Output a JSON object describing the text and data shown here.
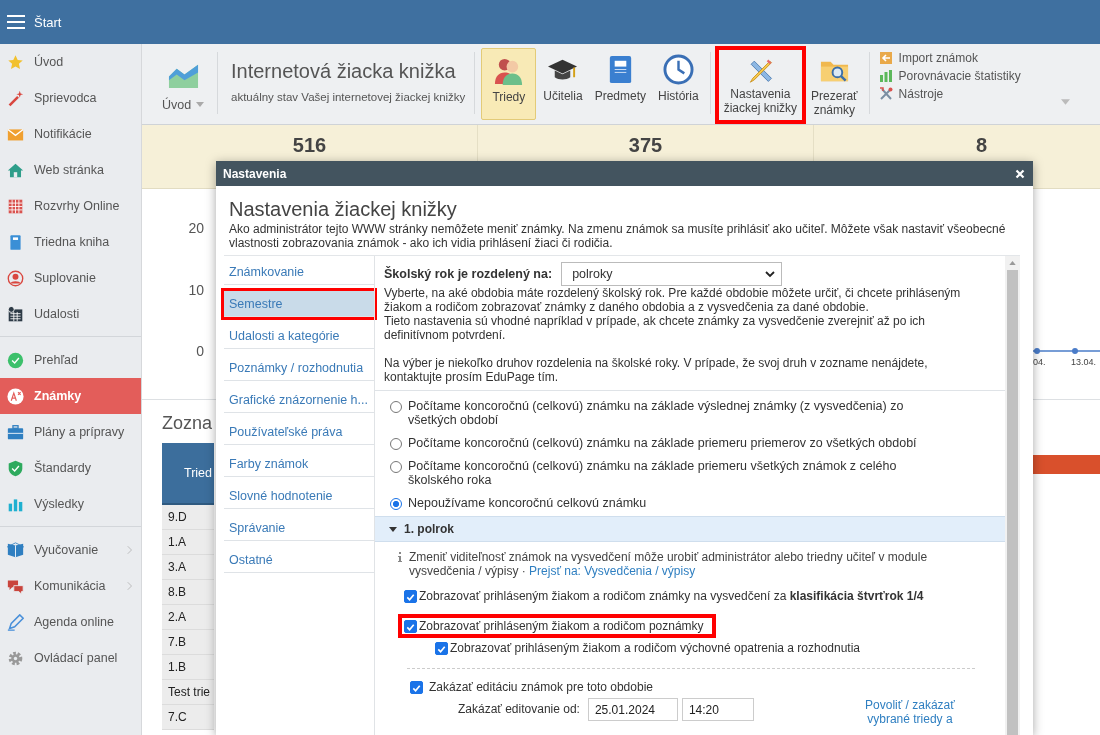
{
  "top_bar": {
    "title": "Štart"
  },
  "sidebar": {
    "groups": [
      [
        {
          "label": "Úvod",
          "selected": false,
          "expandable": false
        },
        {
          "label": "Sprievodca",
          "selected": false,
          "expandable": false
        },
        {
          "label": "Notifikácie",
          "selected": false,
          "expandable": false
        },
        {
          "label": "Web stránka",
          "selected": false,
          "expandable": false
        },
        {
          "label": "Rozvrhy Online",
          "selected": false,
          "expandable": false
        },
        {
          "label": "Triedna kniha",
          "selected": false,
          "expandable": false
        },
        {
          "label": "Suplovanie",
          "selected": false,
          "expandable": false
        },
        {
          "label": "Udalosti",
          "selected": false,
          "expandable": false
        }
      ],
      [
        {
          "label": "Prehľad",
          "selected": false,
          "expandable": false
        },
        {
          "label": "Známky",
          "selected": true,
          "expandable": false
        },
        {
          "label": "Plány a prípravy",
          "selected": false,
          "expandable": false
        },
        {
          "label": "Štandardy",
          "selected": false,
          "expandable": false
        },
        {
          "label": "Výsledky",
          "selected": false,
          "expandable": false
        }
      ],
      [
        {
          "label": "Vyučovanie",
          "selected": false,
          "expandable": true
        },
        {
          "label": "Komunikácia",
          "selected": false,
          "expandable": true
        },
        {
          "label": "Agenda online",
          "selected": false,
          "expandable": false
        },
        {
          "label": "Ovládací panel",
          "selected": false,
          "expandable": false
        }
      ]
    ]
  },
  "toolbar": {
    "home": {
      "label": "Úvod"
    },
    "title": "Internetová žiacka knižka",
    "subtitle": "aktuálny stav Vašej internetovej žiackej knižky",
    "buttons": [
      {
        "label": "Triedy",
        "selected": true,
        "highlighted": false
      },
      {
        "label": "Učitelia",
        "selected": false,
        "highlighted": false
      },
      {
        "label": "Predmety",
        "selected": false,
        "highlighted": false
      },
      {
        "label": "História",
        "selected": false,
        "highlighted": false
      },
      {
        "label": "Nastavenia\nžiackej knižky",
        "selected": false,
        "highlighted": true
      },
      {
        "label": "Prezerať\nznámky",
        "selected": false,
        "highlighted": false
      }
    ],
    "tools": [
      {
        "label": "Import známok"
      },
      {
        "label": "Porovnávacie štatistiky"
      },
      {
        "label": "Nástroje"
      }
    ]
  },
  "stats": [
    "516",
    "375",
    "8"
  ],
  "chart_labels": {
    "y_ticks": [
      "20",
      "10",
      "0"
    ],
    "x_labels": [
      "04.",
      "13.04."
    ]
  },
  "list": {
    "title": "Zozna",
    "columns": [
      "Tried"
    ],
    "rows": [
      "9.D",
      "1.A",
      "3.A",
      "8.B",
      "2.A",
      "7.B",
      "1.B",
      "Test trie",
      "7.C"
    ]
  },
  "dialog": {
    "title": "Nastavenia",
    "heading": "Nastavenia žiackej knižky",
    "description": "Ako administrátor tejto WWW stránky nemôžete meniť známky. Na zmenu známok sa musíte prihlásiť ako učiteľ. Môžete však nastaviť všeobecné vlastnosti zobrazovania známok - ako ich vidia prihlásení žiaci či rodičia.",
    "nav": [
      {
        "label": "Známkovanie",
        "selected": false,
        "highlighted": false
      },
      {
        "label": "Semestre",
        "selected": true,
        "highlighted": true
      },
      {
        "label": "Udalosti a kategórie",
        "selected": false,
        "highlighted": false
      },
      {
        "label": "Poznámky / rozhodnutia",
        "selected": false,
        "highlighted": false
      },
      {
        "label": "Grafické znázornenie h...",
        "selected": false,
        "highlighted": false
      },
      {
        "label": "Používateľské práva",
        "selected": false,
        "highlighted": false
      },
      {
        "label": "Farby známok",
        "selected": false,
        "highlighted": false
      },
      {
        "label": "Slovné hodnotenie",
        "selected": false,
        "highlighted": false
      },
      {
        "label": "Správanie",
        "selected": false,
        "highlighted": false
      },
      {
        "label": "Ostatné",
        "selected": false,
        "highlighted": false
      }
    ],
    "period": {
      "label": "Školský rok je rozdelený na:",
      "value": "polroky"
    },
    "paragraphs": [
      "Vyberte, na aké obdobia máte rozdelený školský rok. Pre každé obdobie môžete určiť, či chcete prihláseným žiakom a rodičom zobrazovať známky z daného obdobia a z vysvedčenia za dané obdobie.",
      "Tieto nastavenia sú vhodné napríklad v prípade, ak chcete známky za vysvedčenie zverejniť až po ich definitívnom potvrdení.",
      "Na výber je niekoľko druhov rozdelenia na školské roky. V prípade, že svoj druh v zozname nenájdete, kontaktujte prosím EduPage tím."
    ],
    "radios": [
      {
        "label": "Počítame koncoročnú (celkovú) známku na základe výslednej známky (z vysvedčenia) zo všetkých období",
        "selected": false
      },
      {
        "label": "Počítame koncoročnú (celkovú) známku na základe priemeru priemerov zo všetkých období",
        "selected": false
      },
      {
        "label": "Počítame koncoročnú (celkovú) známku na základe priemeru všetkých známok z celého školského roka",
        "selected": false
      },
      {
        "label": "Nepoužívame koncoročnú celkovú známku",
        "selected": true
      }
    ],
    "section": {
      "label": "1. polrok",
      "expanded": true,
      "info": {
        "text": "Zmeniť viditeľnosť známok na vysvedčení môže urobiť administrátor alebo triedny učiteľ v module vysvedčenia / výpisy ·",
        "link": "Prejsť na: Vysvedčenia / výpisy"
      },
      "checkboxes": [
        {
          "label": "Zobrazovať prihláseným žiakom a rodičom známky na vysvedčení za **klasifikácia štvrťrok 1/4**",
          "checked": true,
          "highlighted": false
        },
        {
          "label": "Zobrazovať prihláseným žiakom a rodičom poznámky",
          "checked": true,
          "highlighted": true,
          "children": [
            {
              "label": "Zobrazovať prihláseným žiakom a rodičom výchovné opatrenia a rozhodnutia",
              "checked": true
            }
          ]
        }
      ],
      "lock": {
        "label": "Zakázať editáciu známok pre toto obdobie",
        "checked": true
      },
      "lock_from": {
        "label": "Zakázať editovanie od:",
        "date": "25.01.2024",
        "time": "14:20"
      },
      "classes_link": "Povoliť / zakázať vybrané triedy a"
    }
  }
}
